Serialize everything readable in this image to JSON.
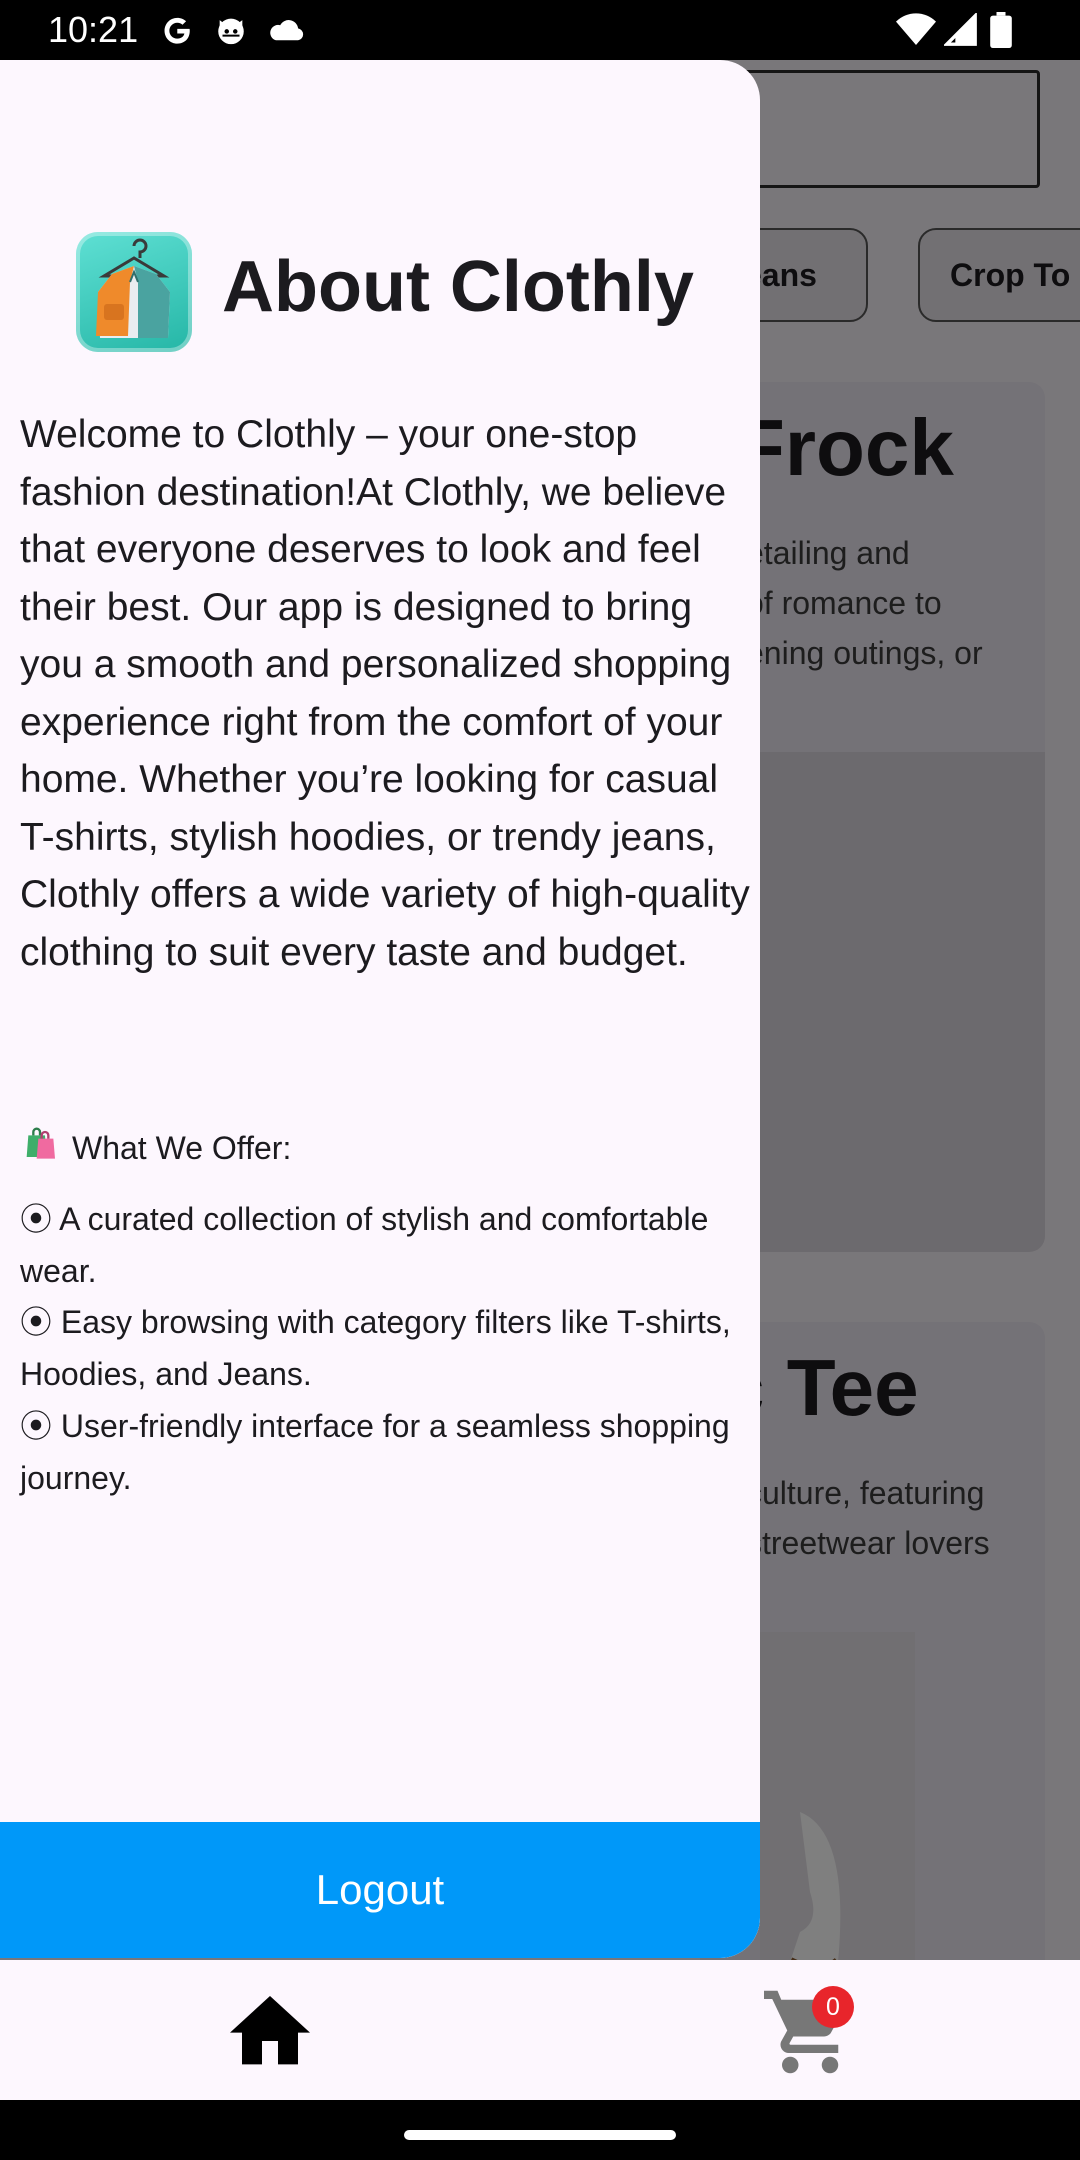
{
  "status_bar": {
    "time": "10:21",
    "left_icons": [
      "google-icon",
      "cat-face-icon",
      "cloud-icon"
    ],
    "right_icons": [
      "wifi-icon",
      "signal-icon",
      "battery-icon"
    ]
  },
  "background": {
    "chips": [
      "eans",
      "Crop To"
    ],
    "cards": [
      {
        "title": "Frock",
        "description": [
          "etailing and",
          "of romance to",
          "ening outings, or"
        ]
      },
      {
        "title": "c Tee",
        "description": [
          "culture, featuring",
          "streetwear lovers"
        ]
      }
    ]
  },
  "drawer": {
    "title": "About Clothly",
    "logo_icon": "clothes-hanger-jacket-icon",
    "about_text": "Welcome to Clothly – your one-stop fashion destination!At Clothly, we believe that everyone deserves to look and feel their best. Our app is designed to bring you a smooth and personalized shopping experience right from the comfort of your home. Whether you’re looking for casual T-shirts, stylish hoodies, or trendy jeans, Clothly offers a wide variety of high-quality clothing to suit every taste and budget.",
    "offer_heading": "What We Offer:",
    "offer_heading_icon": "shopping-bags-icon",
    "offer_items": [
      "⦿ A curated collection of stylish and comfortable wear.",
      "⦿ Easy browsing with category filters like T-shirts, Hoodies, and Jeans.",
      "⦿ User-friendly interface for a seamless shopping journey."
    ],
    "logout_label": "Logout"
  },
  "bottom_nav": {
    "items": [
      {
        "name": "home",
        "icon": "home-icon"
      },
      {
        "name": "cart",
        "icon": "cart-icon",
        "badge": "0"
      }
    ]
  },
  "colors": {
    "logout_button": "#0098f9",
    "drawer_bg": "#fdf7fe",
    "badge": "#e8252b"
  }
}
